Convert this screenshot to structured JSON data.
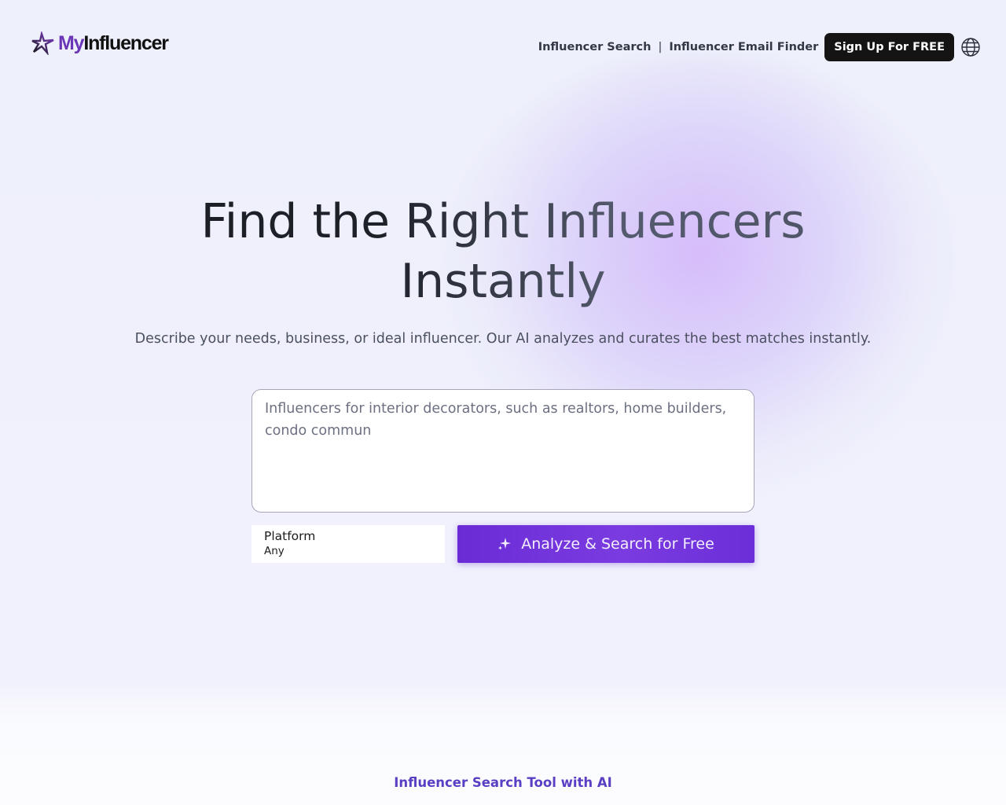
{
  "brand": {
    "name_part1": "My",
    "name_part2": "Influencer",
    "accent_color": "#6b35b7"
  },
  "nav": {
    "links": [
      "Influencer Search",
      "Influencer Email Finder"
    ],
    "separator": "|",
    "signup_label": "Sign Up For FREE",
    "language_icon": "globe-icon"
  },
  "hero": {
    "headline_line1": "Find the Right Influencers",
    "headline_line2": "Instantly",
    "subtitle": "Describe your needs, business, or ideal influencer. Our AI analyzes and curates the best matches instantly."
  },
  "search": {
    "placeholder": "Influencers for interior decorators, such as realtors, home builders, condo commun",
    "platform_label": "Platform",
    "platform_value": "Any",
    "submit_label": "Analyze & Search for Free",
    "submit_icon": "sparkles-icon",
    "button_color": "#6a2bd6"
  },
  "section": {
    "title": "Influencer Search Tool with AI"
  }
}
